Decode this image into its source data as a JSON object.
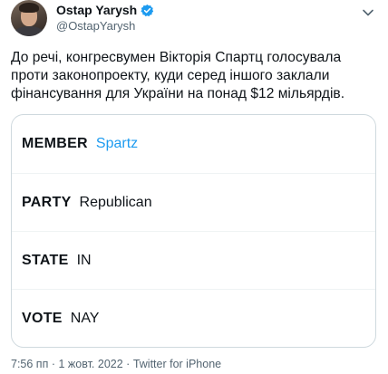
{
  "author": {
    "name": "Ostap Yarysh",
    "handle": "@OstapYarysh"
  },
  "tweet": {
    "lines": [
      "До речі, конгресвумен Вікторія Спартц голосувала",
      "проти законопроекту, куди серед іншого заклали",
      "фінансування для України на понад $12 мільярдів."
    ]
  },
  "card": {
    "rows": [
      {
        "key": "MEMBER",
        "value": "Spartz"
      },
      {
        "key": "PARTY",
        "value": "Republican"
      },
      {
        "key": "STATE",
        "value": "IN"
      },
      {
        "key": "VOTE",
        "value": "NAY"
      }
    ]
  },
  "footer": {
    "time": "7:56 пп",
    "date": "1 жовт. 2022",
    "source": "Twitter for iPhone"
  },
  "colors": {
    "link": "#1d9bf0",
    "text": "#0f1419",
    "secondary": "#536471",
    "border": "#cfd9de"
  },
  "icons": [
    "verified-badge-icon",
    "chevron-down-icon"
  ]
}
